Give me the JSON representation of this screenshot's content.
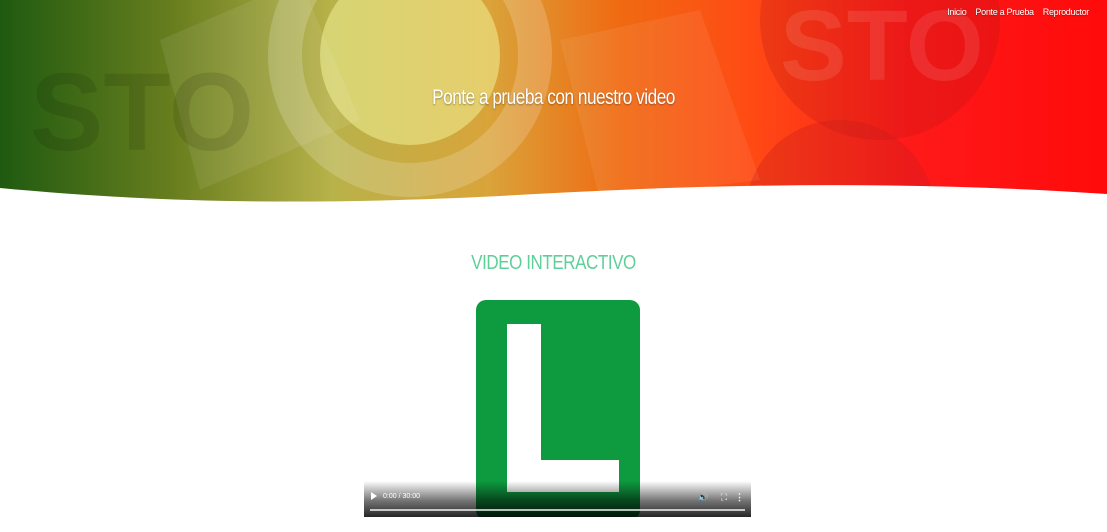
{
  "nav": {
    "items": [
      "Inicio",
      "Ponte a Prueba",
      "Reproductor"
    ]
  },
  "hero": {
    "title": "Ponte a prueba con nuestro video"
  },
  "section": {
    "title": "VIDEO INTERACTIVO"
  },
  "video": {
    "time": "0:00 / 30:00",
    "progress": 0
  },
  "icons": {
    "play": "play-icon",
    "volume": "volume-icon",
    "fullscreen": "fullscreen-icon",
    "more": "more-options-icon",
    "poster": "learner-l-sign"
  },
  "colors": {
    "section_title": "#5fcf9a",
    "l_sign": "#0e9a3f",
    "hero_left": "#1f5a10",
    "hero_right": "#ff0a0a"
  }
}
